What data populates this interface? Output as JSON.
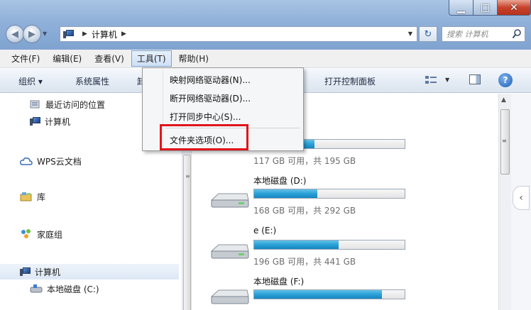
{
  "titlebar": {
    "min": "▁",
    "max": "□",
    "close": "✕"
  },
  "nav": {
    "address_crumb": "计算机",
    "search_placeholder": "搜索 计算机",
    "refresh_glyph": "↻"
  },
  "menubar": {
    "items": [
      {
        "label": "文件(F)"
      },
      {
        "label": "编辑(E)"
      },
      {
        "label": "查看(V)"
      },
      {
        "label": "工具(T)",
        "active": true
      },
      {
        "label": "帮助(H)"
      }
    ]
  },
  "toolbar": {
    "organize": "组织 ▾",
    "system_properties": "系统属性",
    "cut_fragment": "卸",
    "control_panel": "打开控制面板"
  },
  "tools_menu": {
    "items": [
      {
        "label": "映射网络驱动器(N)..."
      },
      {
        "label": "断开网络驱动器(D)..."
      },
      {
        "label": "打开同步中心(S)..."
      },
      {
        "label": "文件夹选项(O)...",
        "highlighted": true
      }
    ]
  },
  "sidebar": {
    "items": [
      {
        "label": "最近访问的位置",
        "icon": "recent-places-icon"
      },
      {
        "label": "计算机",
        "icon": "computer-icon"
      },
      {
        "label": "WPS云文档",
        "icon": "cloud-icon"
      },
      {
        "label": "库",
        "icon": "library-icon"
      },
      {
        "label": "家庭组",
        "icon": "homegroup-icon"
      },
      {
        "label": "计算机",
        "icon": "computer-icon",
        "selected": true
      },
      {
        "label": "本地磁盘 (C:)",
        "icon": "drive-icon"
      }
    ]
  },
  "drives": [
    {
      "name": ":)",
      "used_fraction": 0.4,
      "space": "117 GB 可用，共 195 GB"
    },
    {
      "name": "本地磁盘 (D:)",
      "used_fraction": 0.42,
      "space": "168 GB 可用，共 292 GB"
    },
    {
      "name": "e (E:)",
      "used_fraction": 0.56,
      "space": "196 GB 可用，共 441 GB"
    },
    {
      "name": "本地磁盘 (F:)",
      "used_fraction": 0.85,
      "space": ""
    }
  ],
  "colors": {
    "highlight_red": "#e0141b",
    "bar_blue": "#2aa0d6"
  }
}
